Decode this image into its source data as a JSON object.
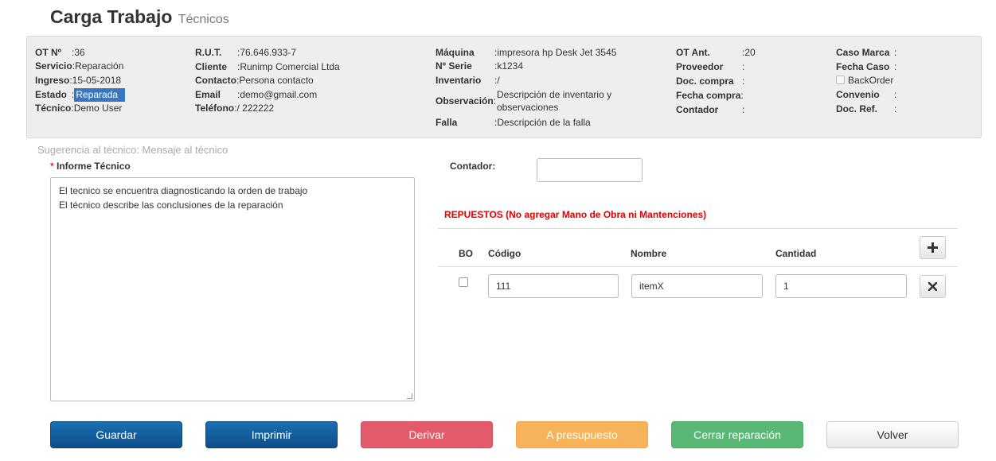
{
  "header": {
    "title": "Carga Trabajo",
    "subtitle": "Técnicos"
  },
  "order": {
    "ot_no": {
      "label": "OT Nº",
      "value": ":36"
    },
    "servicio": {
      "label": "Servicio",
      "value": ":Reparación"
    },
    "ingreso": {
      "label": "Ingreso",
      "value": ":15-05-2018"
    },
    "estado": {
      "label": "Estado",
      "sep": ":",
      "value": "Reparada"
    },
    "tecnico": {
      "label": "Técnico",
      "value": ":Demo User"
    },
    "rut": {
      "label": "R.U.T.",
      "value": ":76.646.933-7"
    },
    "cliente": {
      "label": "Cliente",
      "value": ":Runimp Comercial Ltda"
    },
    "contacto": {
      "label": "Contacto",
      "value": ":Persona contacto"
    },
    "email": {
      "label": "Email",
      "value": ":demo@gmail.com"
    },
    "telefono": {
      "label": "Teléfono",
      "value": ":/ 222222"
    },
    "maquina": {
      "label": "Máquina",
      "value": ":impresora hp Desk Jet 3545"
    },
    "serie": {
      "label": "Nº Serie",
      "value": ":k1234"
    },
    "inventario": {
      "label": "Inventario",
      "value": ":/"
    },
    "observacion": {
      "label": "Observación",
      "value_line1": "Descripción de inventario y",
      "value_line2": "observaciones"
    },
    "falla": {
      "label": "Falla",
      "value": ":Descripción de la falla"
    },
    "ot_ant": {
      "label": "OT Ant.",
      "value": ":20"
    },
    "proveedor": {
      "label": "Proveedor",
      "value": ":"
    },
    "doc_compra": {
      "label": "Doc. compra",
      "value": ":"
    },
    "fecha_compra": {
      "label": "Fecha compra",
      "value": ":"
    },
    "contador": {
      "label": "Contador",
      "value": ":"
    },
    "caso_marca": {
      "label": "Caso Marca",
      "value": ":"
    },
    "fecha_caso": {
      "label": "Fecha Caso",
      "value": ":"
    },
    "backorder": {
      "label": "BackOrder",
      "checked": false
    },
    "convenio": {
      "label": "Convenio",
      "value": ":"
    },
    "doc_ref": {
      "label": "Doc. Ref.",
      "value": ":"
    }
  },
  "hint": "Sugerencia al técnico: Mensaje al técnico",
  "report": {
    "required_mark": "*",
    "label": "Informe Técnico",
    "line1": "El tecnico se encuentra diagnosticando la orden de trabajo",
    "line2": "El técnico describe las conclusiones de la reparación"
  },
  "counter": {
    "label": "Contador:",
    "value": ""
  },
  "parts": {
    "title": "REPUESTOS (No agregar Mano de Obra ni Mantenciones)",
    "headers": {
      "bo": "BO",
      "codigo": "Código",
      "nombre": "Nombre",
      "cantidad": "Cantidad"
    },
    "add_icon": "plus-icon",
    "rows": [
      {
        "bo": false,
        "codigo": "111",
        "nombre": "itemX",
        "cantidad": "1",
        "remove_icon": "close-icon"
      }
    ]
  },
  "actions": {
    "guardar": "Guardar",
    "imprimir": "Imprimir",
    "derivar": "Derivar",
    "presupuesto": "A presupuesto",
    "cerrar": "Cerrar reparación",
    "volver": "Volver"
  },
  "colors": {
    "primary": "#0e5a9b",
    "danger": "#e35b6a",
    "warning": "#f7b35a",
    "success": "#59b875",
    "highlight": "#3876bf",
    "parts_title": "#e60000"
  }
}
